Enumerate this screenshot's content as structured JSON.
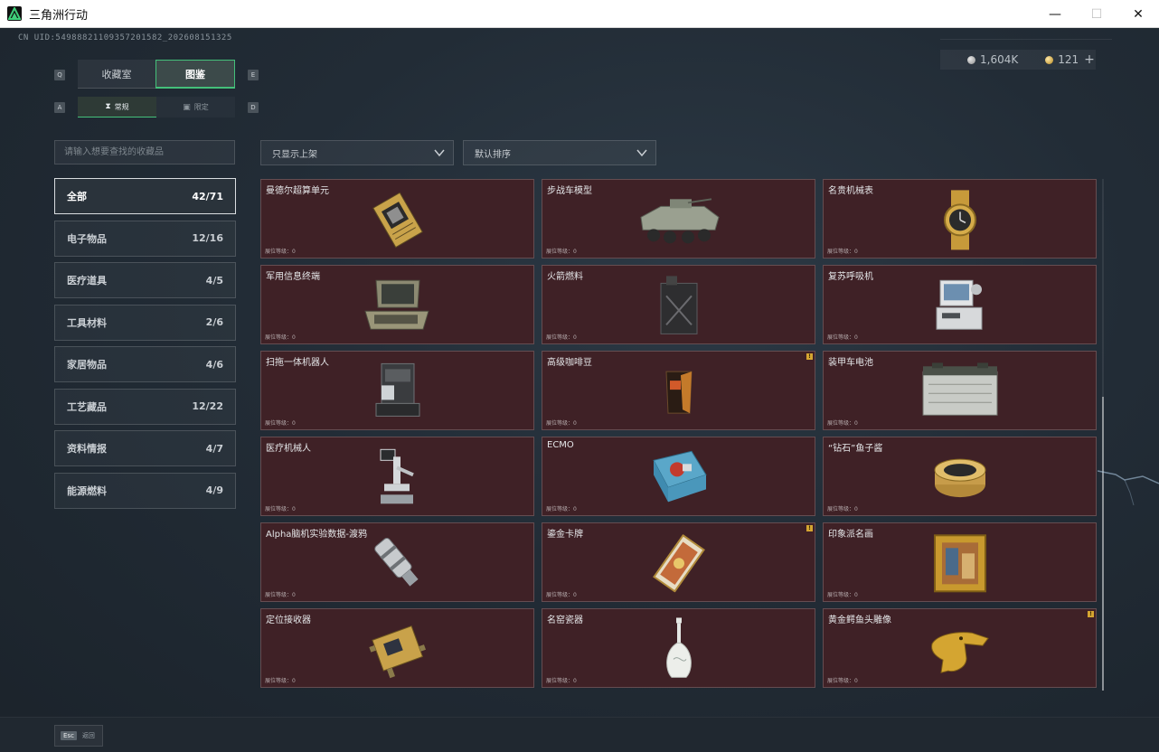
{
  "window": {
    "title": "三角洲行动",
    "minimize": "—",
    "maximize": "☐",
    "close": "✕"
  },
  "uid": "CN UID:5498882110935720158​2_202608151325",
  "currency": {
    "silver": "1,604K",
    "gold": "121",
    "add": "+"
  },
  "keys": {
    "q": "Q",
    "e": "E",
    "a": "A",
    "d": "D"
  },
  "main_tabs": [
    {
      "label": "收藏室"
    },
    {
      "label": "图鉴"
    }
  ],
  "sub_tabs": [
    {
      "label": "常规",
      "icon": "hourglass-icon"
    },
    {
      "label": "限定",
      "icon": "frame-icon"
    }
  ],
  "search": {
    "placeholder": "请输入想要查找的收藏品"
  },
  "filters": [
    {
      "label": "只显示上架"
    },
    {
      "label": "默认排序"
    }
  ],
  "categories": [
    {
      "label": "全部",
      "count": "42/71"
    },
    {
      "label": "电子物品",
      "count": "12/16"
    },
    {
      "label": "医疗道具",
      "count": "4/5"
    },
    {
      "label": "工具材料",
      "count": "2/6"
    },
    {
      "label": "家居物品",
      "count": "4/6"
    },
    {
      "label": "工艺藏品",
      "count": "12/22"
    },
    {
      "label": "资料情报",
      "count": "4/7"
    },
    {
      "label": "能源燃料",
      "count": "4/9"
    }
  ],
  "items": [
    {
      "name": "曼德尔超算单元",
      "level": "展位等级：0",
      "icon": "circuit-board-icon"
    },
    {
      "name": "步战车模型",
      "level": "展位等级：0",
      "icon": "armored-vehicle-icon"
    },
    {
      "name": "名贵机械表",
      "level": "展位等级：0",
      "icon": "watch-icon"
    },
    {
      "name": "军用信息终端",
      "level": "展位等级：0",
      "icon": "rugged-laptop-icon"
    },
    {
      "name": "火箭燃料",
      "level": "展位等级：0",
      "icon": "fuel-canister-icon"
    },
    {
      "name": "复苏呼吸机",
      "level": "展位等级：0",
      "icon": "ventilator-icon"
    },
    {
      "name": "扫拖一体机器人",
      "level": "展位等级：0",
      "icon": "robot-vacuum-icon"
    },
    {
      "name": "高级咖啡豆",
      "level": "展位等级：0",
      "icon": "coffee-bag-icon",
      "flag": "!"
    },
    {
      "name": "装甲车电池",
      "level": "展位等级：0",
      "icon": "battery-icon"
    },
    {
      "name": "医疗机械人",
      "level": "展位等级：0",
      "icon": "medical-robot-icon"
    },
    {
      "name": "ECMO",
      "level": "展位等级：0",
      "icon": "ecmo-machine-icon"
    },
    {
      "name": "“钻石”鱼子酱",
      "level": "展位等级：0",
      "icon": "caviar-tin-icon"
    },
    {
      "name": "Alpha脑机实验数据-渡鸦",
      "level": "展位等级：0",
      "icon": "data-cylinder-icon"
    },
    {
      "name": "鎏金卡牌",
      "level": "展位等级：0",
      "icon": "gilded-card-icon",
      "flag": "!"
    },
    {
      "name": "印象派名画",
      "level": "展位等级：0",
      "icon": "painting-icon"
    },
    {
      "name": "定位接收器",
      "level": "展位等级：0",
      "icon": "gps-receiver-icon"
    },
    {
      "name": "名窑瓷器",
      "level": "展位等级：0",
      "icon": "porcelain-vase-icon"
    },
    {
      "name": "黄金鳄鱼头雕像",
      "level": "展位等级：0",
      "icon": "golden-croc-icon",
      "flag": "!"
    }
  ],
  "bottom": {
    "esc_key": "Esc",
    "back_label": "返回"
  },
  "colors": {
    "accent_green": "#44c07a",
    "card_bg": "#3f2126",
    "flag_gold": "#d4a531"
  }
}
